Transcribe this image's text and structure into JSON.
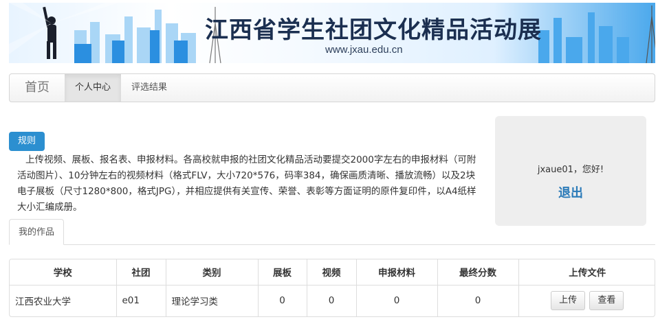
{
  "banner": {
    "title": "江西省学生社团文化精品活动展",
    "url": "www.jxau.edu.cn"
  },
  "nav": {
    "brand": "首页",
    "items": [
      {
        "label": "个人中心",
        "active": true
      },
      {
        "label": "评选结果",
        "active": false
      }
    ]
  },
  "rules": {
    "badge": "规则",
    "text": "上传视频、展板、报名表、申报材料。各高校就申报的社团文化精品活动要提交2000字左右的申报材料（可附活动图片）、10分钟左右的视频材料（格式FLV，大小720*576，码率384，确保画质清晰、播放流畅）以及2块电子展板（尺寸1280*800，格式JPG），并相应提供有关宣传、荣誉、表彰等方面证明的原件复印件，以A4纸样大小汇编成册。"
  },
  "user": {
    "greeting": "jxaue01，您好!",
    "logout": "退出"
  },
  "tabs": [
    {
      "label": "我的作品"
    }
  ],
  "table": {
    "headers": [
      "学校",
      "社团",
      "类别",
      "展板",
      "视频",
      "申报材料",
      "最终分数",
      "上传文件"
    ],
    "rows": [
      {
        "school": "江西农业大学",
        "club": "e01",
        "category": "理论学习类",
        "board": "0",
        "video": "0",
        "material": "0",
        "score": "0",
        "upload_label": "上传",
        "view_label": "查看"
      }
    ]
  },
  "colors": {
    "accent": "#2c8fd0",
    "logout": "#2a7ab8"
  }
}
